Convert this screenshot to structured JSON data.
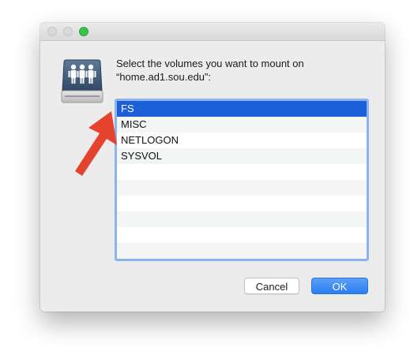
{
  "window": {
    "prompt_line1": "Select the volumes you want to mount on",
    "prompt_line2": "“home.ad1.sou.edu”:"
  },
  "volumes": {
    "items": [
      "FS",
      "MISC",
      "NETLOGON",
      "SYSVOL"
    ],
    "selected": "FS"
  },
  "buttons": {
    "cancel_label": "Cancel",
    "ok_label": "OK"
  },
  "icons": {
    "server": "shared-server-drive-icon",
    "annotation": "red-arrow-icon"
  },
  "colors": {
    "selection": "#1d5fd6",
    "primary_button": "#2c7df1",
    "annotation_arrow": "#e6432e"
  }
}
